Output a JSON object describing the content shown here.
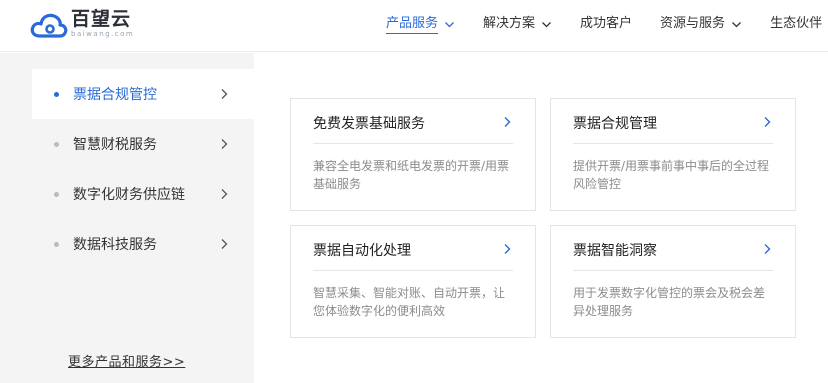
{
  "brand": {
    "name_cn": "百望云",
    "name_en": "baiwang.com"
  },
  "nav": [
    {
      "label": "产品服务",
      "has_dropdown": true,
      "active": true
    },
    {
      "label": "解决方案",
      "has_dropdown": true,
      "active": false
    },
    {
      "label": "成功客户",
      "has_dropdown": false,
      "active": false
    },
    {
      "label": "资源与服务",
      "has_dropdown": true,
      "active": false
    },
    {
      "label": "生态伙伴",
      "has_dropdown": true,
      "active": false
    }
  ],
  "sidebar": {
    "items": [
      {
        "label": "票据合规管控",
        "active": true
      },
      {
        "label": "智慧财税服务",
        "active": false
      },
      {
        "label": "数字化财务供应链",
        "active": false
      },
      {
        "label": "数据科技服务",
        "active": false
      }
    ],
    "more_link": "更多产品和服务>>"
  },
  "cards": [
    {
      "title": "免费发票基础服务",
      "desc": "兼容全电发票和纸电发票的开票/用票基础服务"
    },
    {
      "title": "票据合规管理",
      "desc": "提供开票/用票事前事中事后的全过程风险管控"
    },
    {
      "title": "票据自动化处理",
      "desc": "智慧采集、智能对账、自动开票，让您体验数字化的便利高效"
    },
    {
      "title": "票据智能洞察",
      "desc": "用于发票数字化管控的票会及税会差异处理服务"
    }
  ],
  "colors": {
    "accent": "#2a6ad8",
    "sidebar_bg": "#f4f4f4",
    "muted_text": "#8c8c8c"
  }
}
